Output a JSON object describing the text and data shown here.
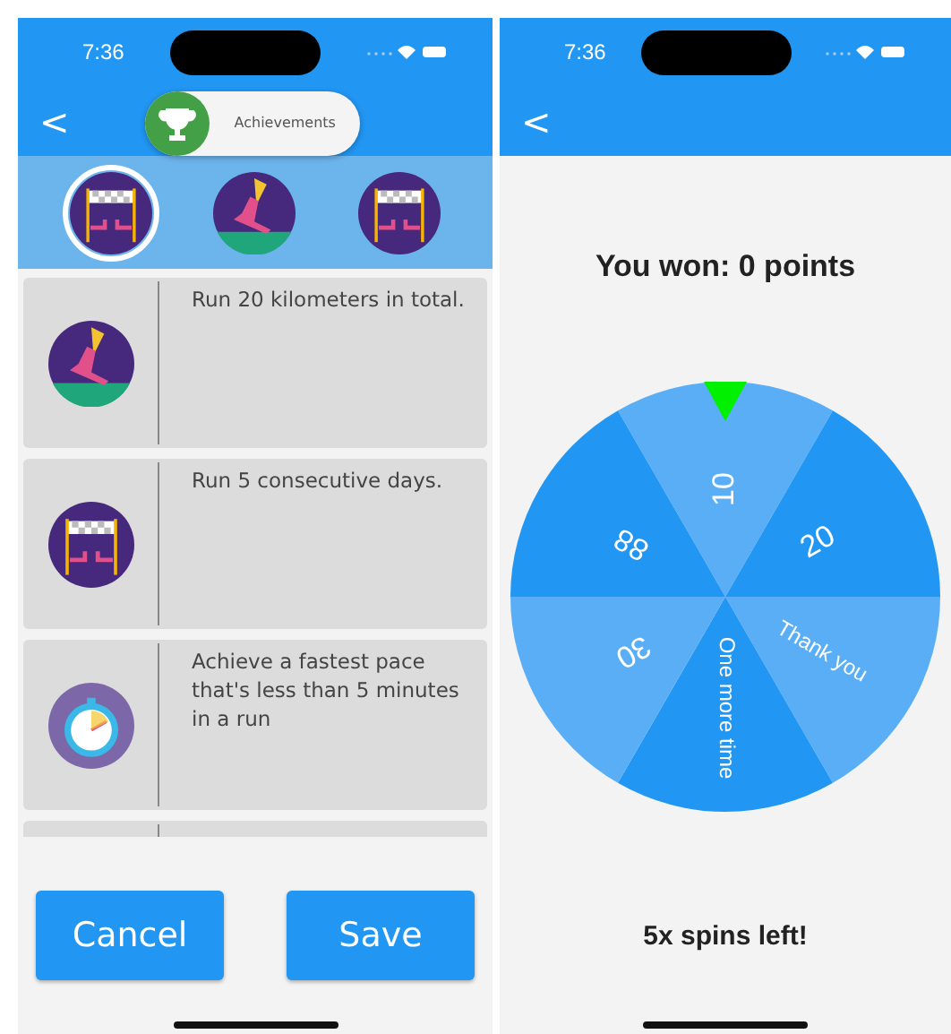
{
  "left_screen": {
    "status_bar": {
      "time": "7:36"
    },
    "nav": {
      "back": "<",
      "title": "Achievements"
    },
    "badges": [
      {
        "kind": "finish",
        "selected": true
      },
      {
        "kind": "shoe",
        "selected": false
      },
      {
        "kind": "finish",
        "selected": false
      }
    ],
    "cards": [
      {
        "kind": "shoe",
        "text": "Run 20 kilometers in total."
      },
      {
        "kind": "finish",
        "text": "Run 5 consecutive days."
      },
      {
        "kind": "stopwatch",
        "text": "Achieve a fastest pace that's less than 5 minutes in a run"
      }
    ],
    "buttons": [
      "Cancel",
      "Save"
    ]
  },
  "right_screen": {
    "status_bar": {
      "time": "7:36"
    },
    "nav": {
      "back": "<"
    },
    "result": "You won: 0 points",
    "wheel": [
      {
        "label": "10",
        "color": "#5aaef5"
      },
      {
        "label": "20",
        "color": "#2196f3"
      },
      {
        "label": "Thank you",
        "color": "#5aaef5"
      },
      {
        "label": "One more time",
        "color": "#2196f3"
      },
      {
        "label": "30",
        "color": "#5aaef5"
      },
      {
        "label": "88",
        "color": "#2196f3"
      }
    ],
    "spins_left": "5x spins left!"
  }
}
